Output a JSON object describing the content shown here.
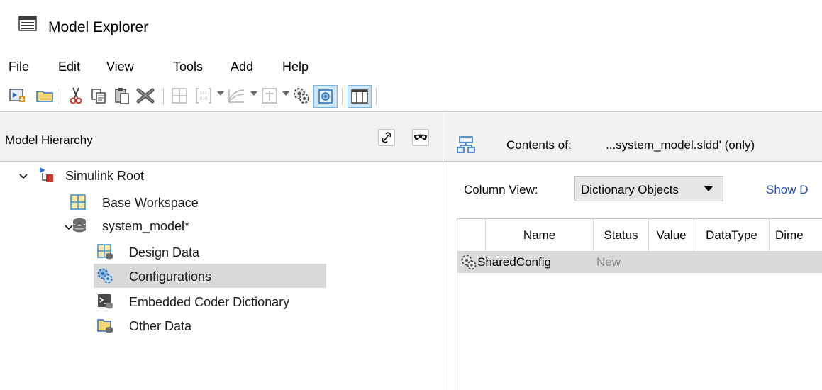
{
  "window": {
    "title": "Model Explorer"
  },
  "menu": [
    "File",
    "Edit",
    "View",
    "Tools",
    "Add",
    "Help"
  ],
  "toolbar": {
    "icons": [
      "new-model-icon",
      "open-folder-icon",
      "cut-icon",
      "copy-icon",
      "paste-icon",
      "delete-icon",
      "grid-icon",
      "array-icon",
      "chart-icon",
      "fixed-point-icon",
      "config-icon",
      "selected-config-icon",
      "column-view-icon"
    ]
  },
  "hierarchy": {
    "title": "Model Hierarchy",
    "nodes": [
      {
        "label": "Simulink Root",
        "expanded": true,
        "icon": "simulink-root-icon"
      },
      {
        "label": "Base Workspace",
        "icon": "workspace-icon"
      },
      {
        "label": "system_model*",
        "expanded": true,
        "icon": "database-icon"
      },
      {
        "label": "Design Data",
        "icon": "design-data-icon"
      },
      {
        "label": "Configurations",
        "icon": "configurations-icon",
        "selected": true
      },
      {
        "label": "Embedded Coder Dictionary",
        "icon": "embedded-coder-icon"
      },
      {
        "label": "Other Data",
        "icon": "other-data-icon"
      }
    ]
  },
  "contents": {
    "label": "Contents of:",
    "path": "...system_model.sldd'  (only)",
    "column_view_label": "Column View:",
    "column_view_value": "Dictionary Objects",
    "show_link": "Show D",
    "columns": [
      "Name",
      "Status",
      "Value",
      "DataType",
      "Dime"
    ],
    "rows": [
      {
        "name": "SharedConfig",
        "status": "New",
        "icon": "config-set-icon"
      }
    ]
  },
  "colors": {
    "selection": "#d9d9d9",
    "link": "#1f4fa8",
    "pane_header": "#f2f2f2",
    "toolbar_active": "#cfe6f7"
  }
}
